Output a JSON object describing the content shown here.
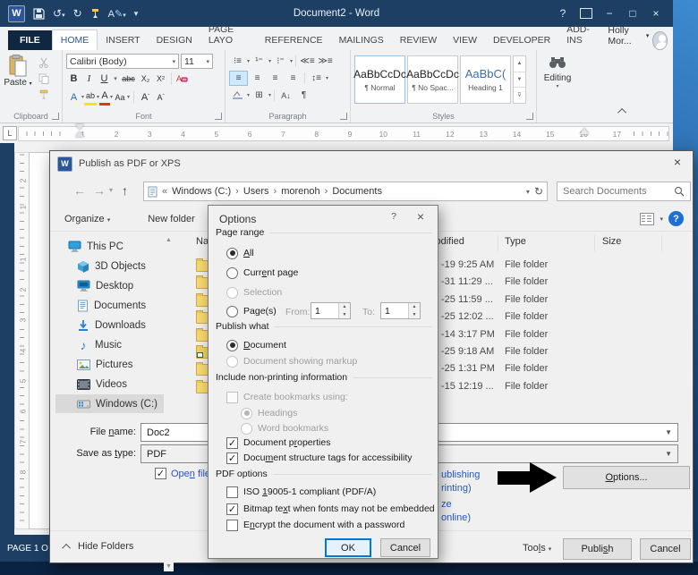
{
  "word": {
    "titlebar": {
      "title": "Document2 - Word",
      "controls": {
        "help": "?",
        "minimize": "−",
        "maximize": "□",
        "close": "×"
      },
      "qat": {
        "undo": "↺",
        "redo": "↻",
        "more": "▾"
      }
    },
    "tabs": {
      "file": "FILE",
      "items": [
        "HOME",
        "INSERT",
        "DESIGN",
        "PAGE LAYO",
        "REFERENCE",
        "MAILINGS",
        "REVIEW",
        "VIEW",
        "DEVELOPER",
        "ADD-INS"
      ],
      "account": "Holly Mor..."
    },
    "ribbon": {
      "clipboard": {
        "paste": "Paste",
        "label": "Clipboard"
      },
      "font": {
        "family": "Calibri (Body)",
        "size": "11",
        "label": "Font",
        "bold": "B",
        "italic": "I",
        "underline": "U",
        "strike": "abc",
        "sub": "X₂",
        "sup": "X²",
        "fancy": "A",
        "highlight": "ab",
        "color": "A",
        "case": "Aa",
        "grow": "A",
        "shrink": "A"
      },
      "paragraph": {
        "label": "Paragraph",
        "pilcrow": "¶",
        "sort": "A↓"
      },
      "styles": {
        "label": "Styles",
        "items": [
          {
            "sample": "AaBbCcDc",
            "name": "¶ Normal"
          },
          {
            "sample": "AaBbCcDc",
            "name": "¶ No Spac..."
          },
          {
            "sample": "AaBbC(",
            "name": "Heading 1"
          }
        ]
      },
      "editing": {
        "label": "Editing"
      }
    },
    "ruler": {
      "h": [
        "1",
        "2",
        "3",
        "4",
        "5",
        "6",
        "7",
        "8",
        "9",
        "10",
        "11",
        "12",
        "13",
        "14",
        "15",
        "16",
        "17"
      ],
      "v_top": [
        "2",
        "1"
      ],
      "v": [
        "1",
        "2",
        "3",
        "4",
        "5",
        "6",
        "7",
        "8"
      ]
    },
    "statusbar": {
      "text": "PAGE 1 O"
    }
  },
  "dialog": {
    "title": "Publish as PDF or XPS",
    "close": "×",
    "nav": {
      "back": "←",
      "forward": "→",
      "up": "↑",
      "dropdown": "▾",
      "refresh": "↻",
      "breadcrumb": {
        "prefix": "«",
        "separator": "›",
        "items": [
          "Windows (C:)",
          "Users",
          "morenoh",
          "Documents"
        ]
      },
      "search_placeholder": "Search Documents"
    },
    "toolbar": {
      "organize": "Organize",
      "new_folder": "New folder",
      "help": "?"
    },
    "sidebar": {
      "items": [
        {
          "label": "This PC",
          "icon": "pc"
        },
        {
          "label": "3D Objects",
          "icon": "cube"
        },
        {
          "label": "Desktop",
          "icon": "desktop"
        },
        {
          "label": "Documents",
          "icon": "documents"
        },
        {
          "label": "Downloads",
          "icon": "downloads"
        },
        {
          "label": "Music",
          "icon": "music"
        },
        {
          "label": "Pictures",
          "icon": "pictures"
        },
        {
          "label": "Videos",
          "icon": "videos"
        },
        {
          "label": "Windows (C:)",
          "icon": "drive"
        }
      ]
    },
    "filelist": {
      "columns": {
        "name": "Name",
        "modified": "Date modified",
        "type": "Type",
        "size": "Size"
      },
      "rows": [
        {
          "date": "-19 9:25 AM",
          "type": "File folder",
          "icon": "folder"
        },
        {
          "date": "-31 11:29 ...",
          "type": "File folder",
          "icon": "folder"
        },
        {
          "date": "-25 11:59 ...",
          "type": "File folder",
          "icon": "folder"
        },
        {
          "date": "-25 12:02 ...",
          "type": "File folder",
          "icon": "folder"
        },
        {
          "date": "-14 3:17 PM",
          "type": "File folder",
          "icon": "folder"
        },
        {
          "date": "-25 9:18 AM",
          "type": "File folder",
          "icon": "folder-shortcut"
        },
        {
          "date": "-25 1:31 PM",
          "type": "File folder",
          "icon": "folder"
        },
        {
          "date": "-15 12:19 ...",
          "type": "File folder",
          "icon": "folder"
        }
      ]
    },
    "fields": {
      "file_name_label": {
        "pre": "File ",
        "acc": "n",
        "post": "ame:"
      },
      "file_name_value": "Doc2",
      "save_type_label": {
        "pre": "Save as ",
        "acc": "t",
        "post": "ype:"
      },
      "save_type_value": "PDF"
    },
    "open_after": {
      "pre": "Ope",
      "acc": "n",
      "post": " file a"
    },
    "optimize_fragments": [
      "ublishing",
      "rinting)",
      "ze",
      "online)"
    ],
    "options_button": {
      "pre": "",
      "acc": "O",
      "post": "ptions..."
    },
    "footer": {
      "hide_folders": "Hide Folders",
      "tools": {
        "pre": "Too",
        "acc": "l",
        "post": "s"
      },
      "publish": {
        "pre": "Publi",
        "acc": "s",
        "post": "h"
      },
      "cancel": "Cancel"
    }
  },
  "options_dialog": {
    "title": "Options",
    "help": "?",
    "close": "×",
    "page_range": {
      "label": "Page range",
      "all": {
        "pre": "",
        "acc": "A",
        "post": "ll"
      },
      "current": {
        "pre": "Curr",
        "acc": "e",
        "post": "nt page"
      },
      "selection": "Selection",
      "pages": {
        "pre": "Pa",
        "acc": "g",
        "post": "e(s)"
      },
      "from_label": "From:",
      "from_value": "1",
      "to_label": "To:",
      "to_value": "1"
    },
    "publish_what": {
      "label": "Publish what",
      "document": {
        "pre": "",
        "acc": "D",
        "post": "ocument"
      },
      "markup": "Document showing markup"
    },
    "non_printing": {
      "label": "Include non-printing information",
      "create_bookmarks": "Create bookmarks using:",
      "headings": "Headings",
      "word_bookmarks": "Word bookmarks",
      "doc_props": {
        "pre": "Document p",
        "acc": "r",
        "post": "operties"
      },
      "structure": {
        "pre": "Docu",
        "acc": "m",
        "post": "ent structure tags for accessibility"
      }
    },
    "pdf_options": {
      "label": "PDF options",
      "iso": {
        "pre": "ISO ",
        "acc": "1",
        "post": "9005-1 compliant (PDF/A)"
      },
      "bitmap": {
        "pre": "Bitmap te",
        "acc": "x",
        "post": "t when fonts may not be embedded"
      },
      "encrypt": {
        "pre": "E",
        "acc": "n",
        "post": "crypt the document with a password"
      }
    },
    "ok": "OK",
    "cancel": "Cancel"
  }
}
